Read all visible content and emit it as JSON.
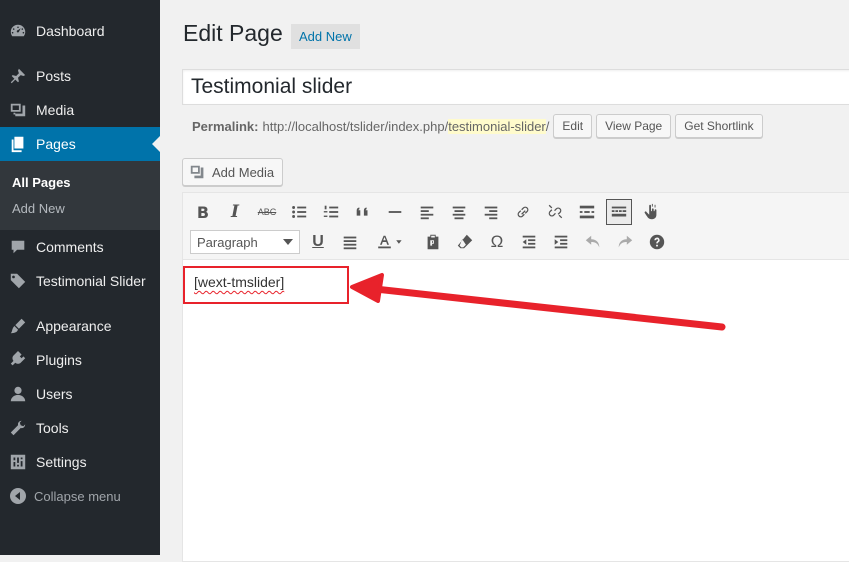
{
  "sidebar": {
    "items": [
      {
        "label": "Dashboard",
        "icon": "dashboard-icon"
      },
      {
        "label": "Posts",
        "icon": "pin-icon"
      },
      {
        "label": "Media",
        "icon": "media-icon"
      },
      {
        "label": "Pages",
        "icon": "pages-icon"
      },
      {
        "label": "Comments",
        "icon": "comment-icon"
      },
      {
        "label": "Testimonial Slider",
        "icon": "tag-icon"
      },
      {
        "label": "Appearance",
        "icon": "brush-icon"
      },
      {
        "label": "Plugins",
        "icon": "plugin-icon"
      },
      {
        "label": "Users",
        "icon": "user-icon"
      },
      {
        "label": "Tools",
        "icon": "wrench-icon"
      },
      {
        "label": "Settings",
        "icon": "settings-icon"
      }
    ],
    "submenu": {
      "all_pages": "All Pages",
      "add_new": "Add New"
    },
    "collapse_label": "Collapse menu"
  },
  "header": {
    "title": "Edit Page",
    "add_new_label": "Add New"
  },
  "post_title": "Testimonial slider",
  "permalink": {
    "label": "Permalink:",
    "base": "http://localhost/tslider/index.php/",
    "slug": "testimonial-slider",
    "trail": "/",
    "edit_label": "Edit",
    "view_label": "View Page",
    "shortlink_label": "Get Shortlink"
  },
  "add_media_label": "Add Media",
  "editor": {
    "format_value": "Paragraph",
    "content": "[wext-tmslider]"
  },
  "colors": {
    "sidebar_bg": "#23282d",
    "active_blue": "#0073aa",
    "annotation_red": "#e8222b",
    "slug_highlight": "#fffbcc"
  }
}
